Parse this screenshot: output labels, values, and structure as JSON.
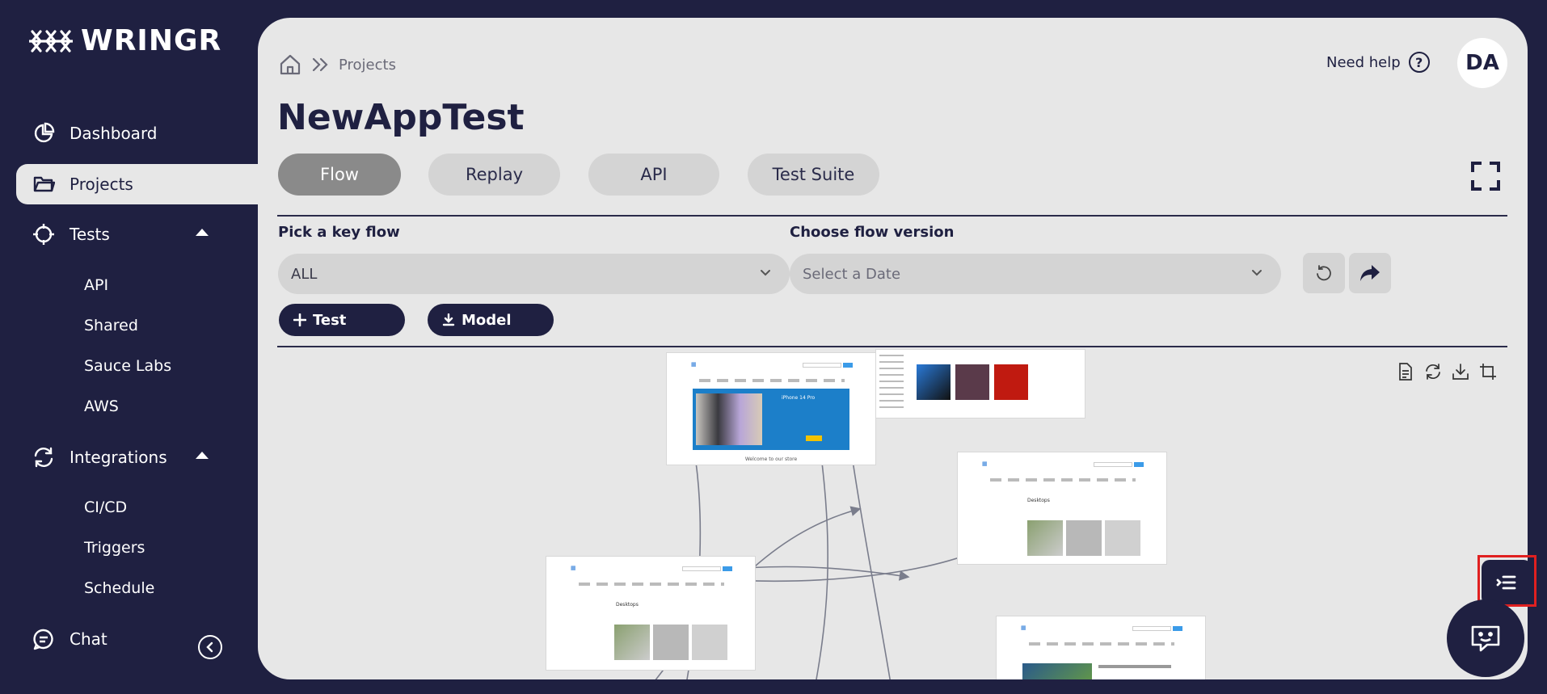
{
  "app": {
    "name": "WRINGR"
  },
  "sidebar": {
    "items": [
      {
        "label": "Dashboard",
        "icon": "pie-chart-icon"
      },
      {
        "label": "Projects",
        "icon": "folder-icon",
        "active": true
      },
      {
        "label": "Tests",
        "icon": "crosshair-icon",
        "expanded": true,
        "children": [
          "API",
          "Shared",
          "Sauce Labs",
          "AWS"
        ]
      },
      {
        "label": "Integrations",
        "icon": "refresh-icon",
        "expanded": true,
        "children": [
          "CI/CD",
          "Triggers",
          "Schedule"
        ]
      },
      {
        "label": "Chat",
        "icon": "chat-bubble-icon"
      }
    ],
    "collapse_icon": "chevron-left-circle-icon"
  },
  "header": {
    "breadcrumb": {
      "home_icon": "home-icon",
      "separator_icon": "double-chevron-right-icon",
      "current": "Projects"
    },
    "help_label": "Need help",
    "help_icon_glyph": "?",
    "avatar_initials": "DA"
  },
  "main": {
    "title": "NewAppTest",
    "tabs": [
      {
        "label": "Flow",
        "active": true
      },
      {
        "label": "Replay"
      },
      {
        "label": "API"
      },
      {
        "label": "Test Suite"
      }
    ],
    "filters": {
      "key_flow": {
        "label": "Pick a key flow",
        "value": "ALL"
      },
      "flow_version": {
        "label": "Choose flow version",
        "placeholder": "Select a Date"
      }
    },
    "actions": {
      "add_test": "Test",
      "download_model": "Model"
    },
    "canvas_tools": [
      "document-icon",
      "refresh-icon",
      "download-icon",
      "crop-icon",
      "rotate-icon"
    ],
    "flow_nodes": [
      {
        "kind": "home",
        "caption": "Welcome to our store",
        "banner_title": "iPhone 14 Pro"
      },
      {
        "kind": "category"
      },
      {
        "kind": "category",
        "heading": "Desktops"
      },
      {
        "kind": "category",
        "heading": "Desktops"
      },
      {
        "kind": "product"
      }
    ]
  },
  "floating": {
    "list_button_icon": "list-menu-icon",
    "chat_button_icon": "chatbot-icon"
  },
  "colors": {
    "navy": "#1f2041",
    "panel": "#e7e7e7",
    "pill": "#d4d4d4",
    "active_tab": "#8a8a8a",
    "highlight": "#e02020"
  }
}
